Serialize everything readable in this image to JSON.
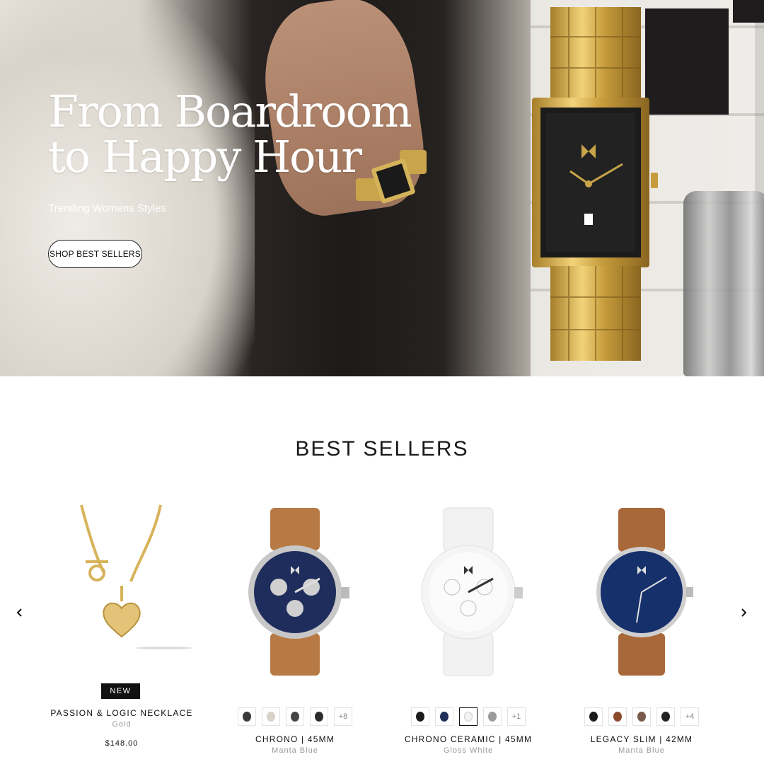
{
  "hero": {
    "title": "From Boardroom\nto Happy Hour",
    "subtitle": "Trending Womens Styles",
    "cta": "SHOP BEST SELLERS"
  },
  "best_sellers": {
    "title": "BEST SELLERS",
    "prev_icon": "chevron-left-icon",
    "next_icon": "chevron-right-icon",
    "products": [
      {
        "name": "PASSION & LOGIC NECKLACE",
        "variant": "Gold",
        "price": "$148.00",
        "badge": "NEW"
      },
      {
        "name": "CHRONO | 45MM",
        "variant": "Manta Blue",
        "swatches": [
          "#3a3a3a",
          "#d9d2c8",
          "#444444",
          "#2b2b2b"
        ],
        "more": "+8"
      },
      {
        "name": "CHRONO CERAMIC | 45MM",
        "variant": "Gloss White",
        "swatches": [
          "#1a1a1a",
          "#1f2f5a",
          "#f3f3f3",
          "#9a9a9a"
        ],
        "more": "+1"
      },
      {
        "name": "LEGACY SLIM | 42MM",
        "variant": "Manta Blue",
        "swatches": [
          "#1b1b1b",
          "#8a4a2c",
          "#7a5a4a",
          "#222222"
        ],
        "more": "+4"
      }
    ]
  }
}
